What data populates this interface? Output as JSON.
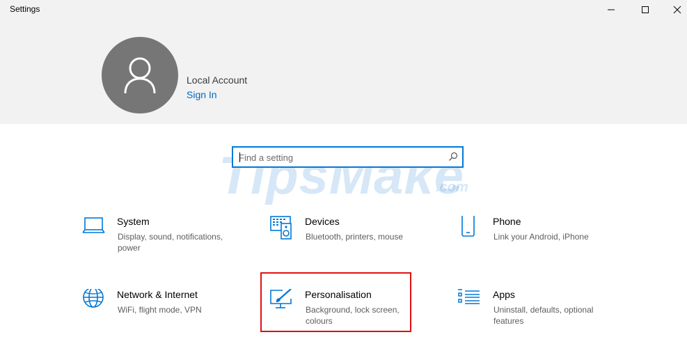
{
  "window": {
    "title": "Settings",
    "controls": [
      "minimize",
      "maximize",
      "close"
    ]
  },
  "account": {
    "name": "Local Account",
    "sign_in_label": "Sign In"
  },
  "search": {
    "placeholder": "Find a setting",
    "value": ""
  },
  "watermark": {
    "main": "TipsMake",
    "suffix": ".com"
  },
  "categories": [
    {
      "title": "System",
      "description": "Display, sound, notifications, power",
      "icon": "laptop-icon"
    },
    {
      "title": "Devices",
      "description": "Bluetooth, printers, mouse",
      "icon": "keyboard-speaker-icon"
    },
    {
      "title": "Phone",
      "description": "Link your Android, iPhone",
      "icon": "phone-icon"
    },
    {
      "title": "Network & Internet",
      "description": "WiFi, flight mode, VPN",
      "icon": "globe-icon"
    },
    {
      "title": "Personalisation",
      "description": "Background, lock screen, colours",
      "icon": "paint-monitor-icon"
    },
    {
      "title": "Apps",
      "description": "Uninstall, defaults, optional features",
      "icon": "apps-list-icon"
    }
  ],
  "colors": {
    "accent": "#0078d7",
    "link": "#0067c0",
    "header_bg": "#f2f2f2",
    "avatar_bg": "#767676",
    "highlight": "#e01010"
  }
}
